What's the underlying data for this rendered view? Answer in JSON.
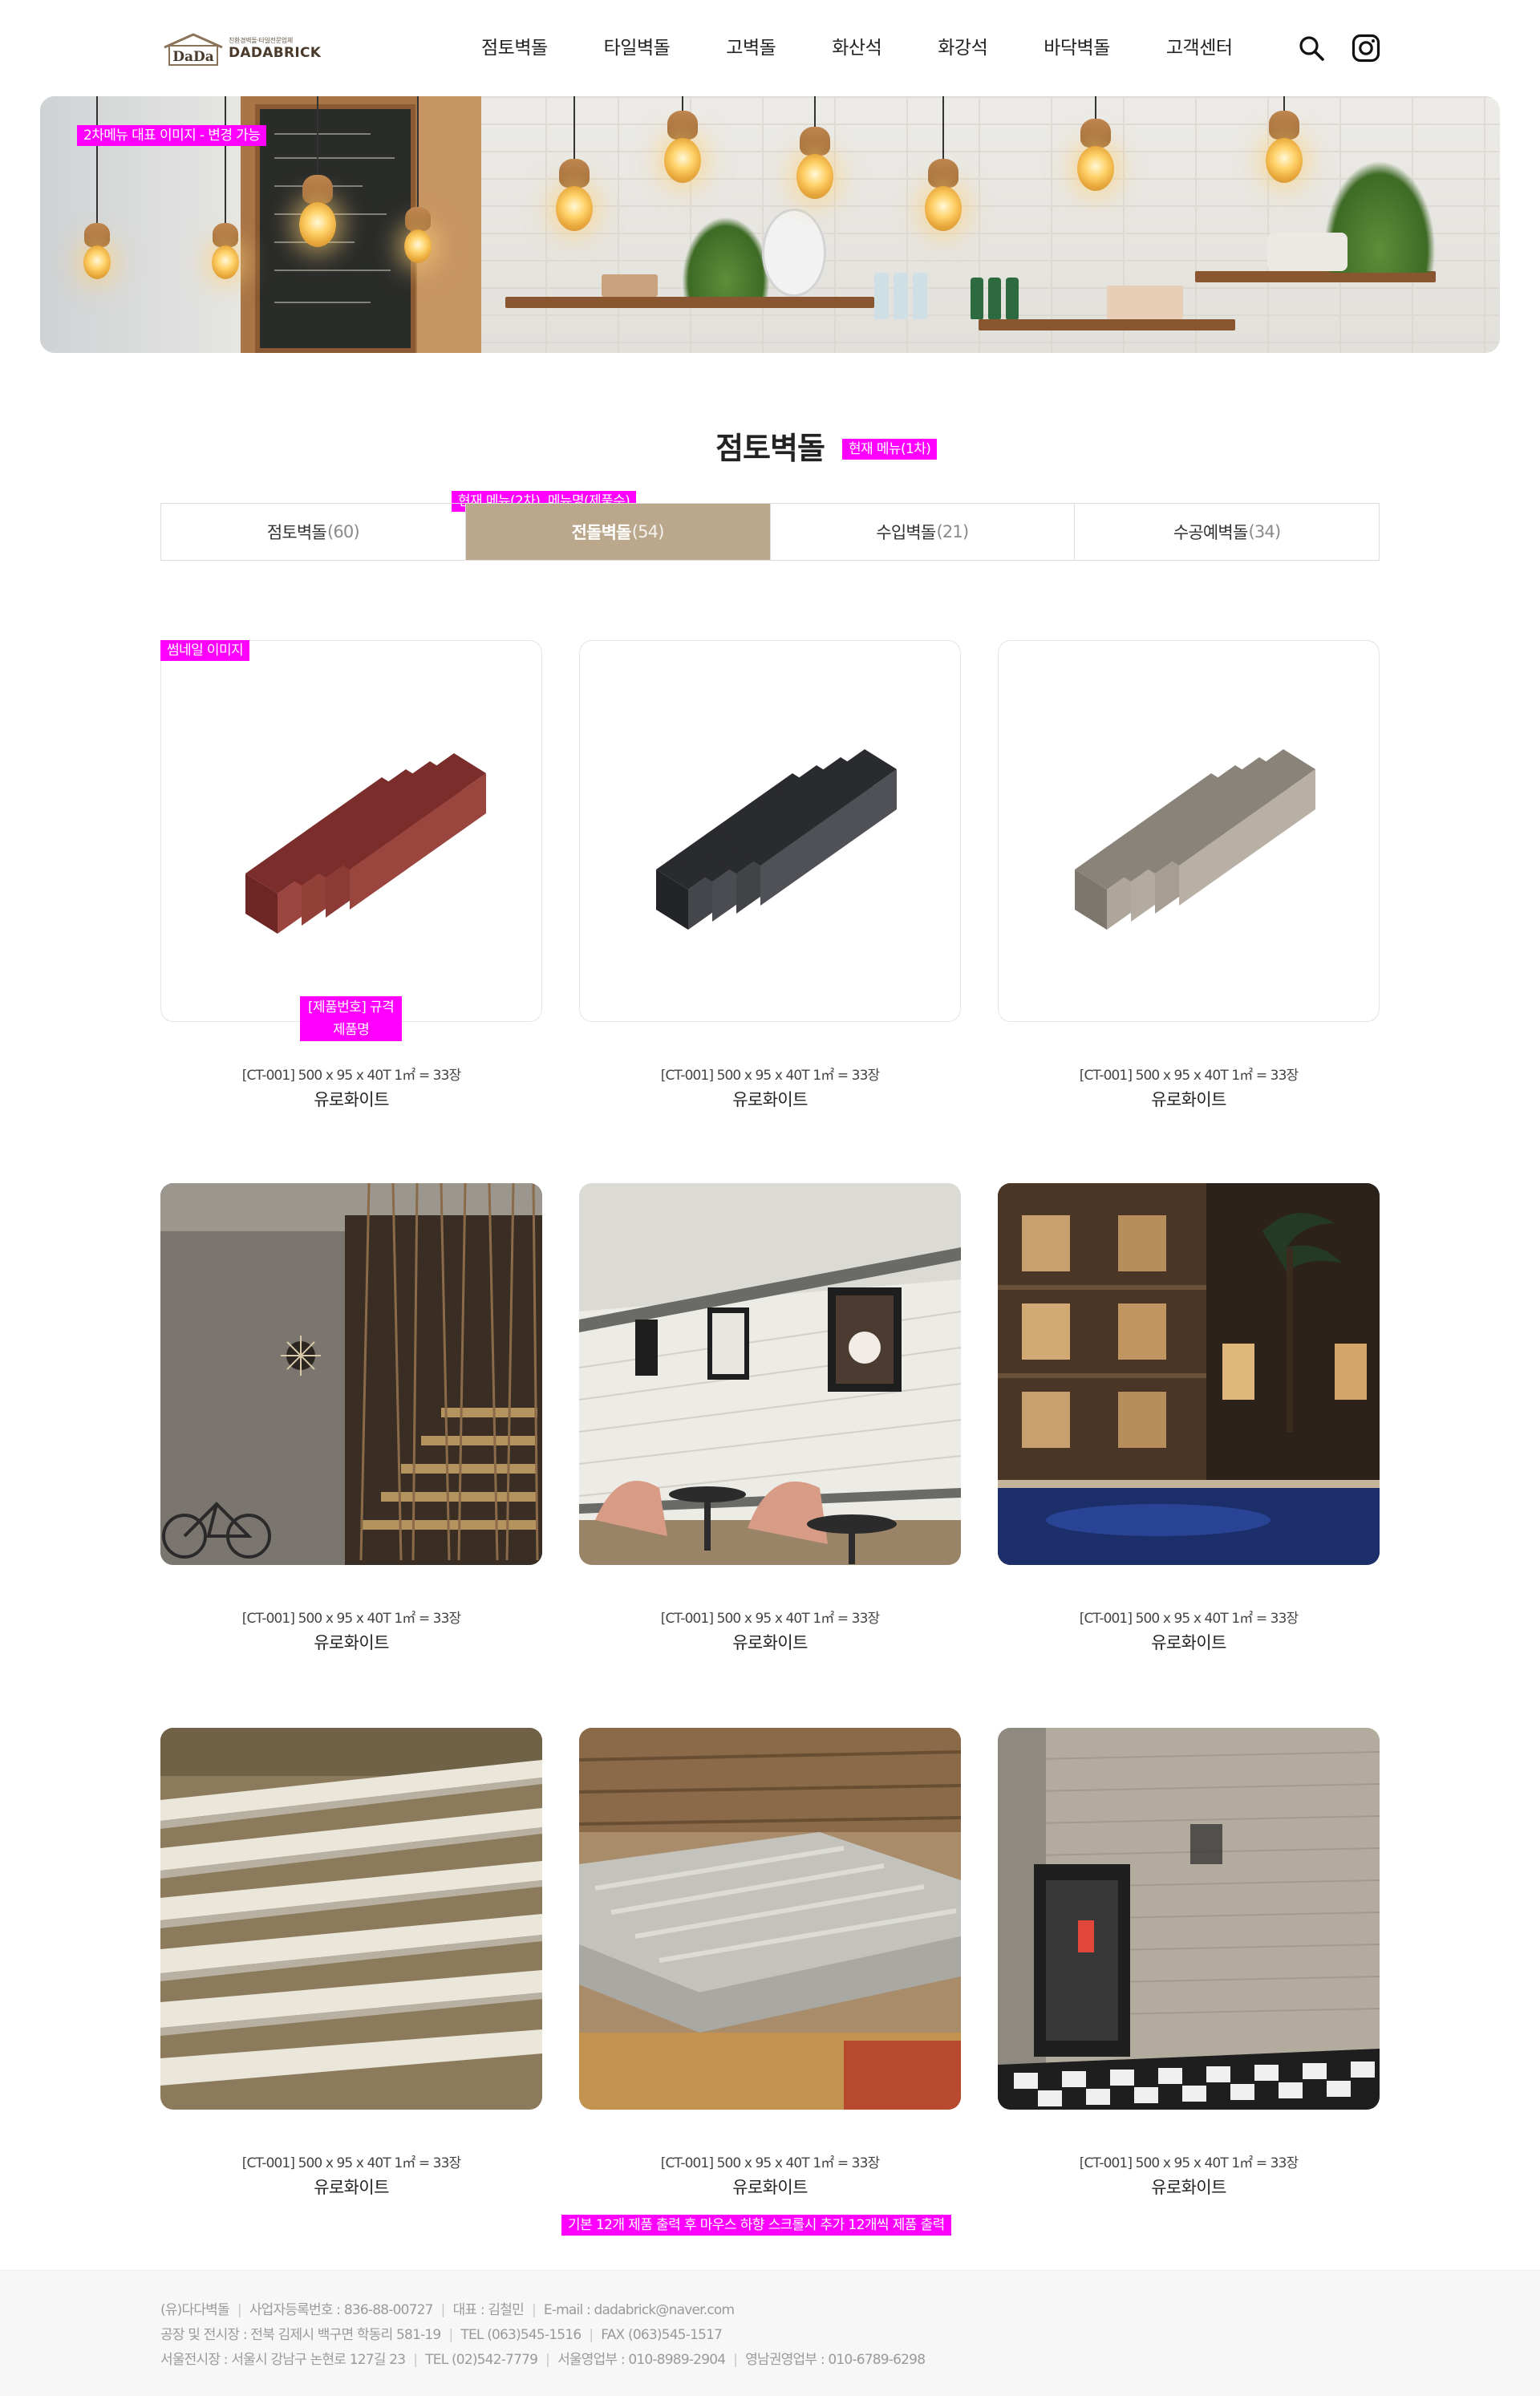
{
  "header": {
    "logo": {
      "brand": "DADABRICK",
      "tagline": "친환경벽돌·타일전문업체",
      "logo_letters": "DaDa"
    },
    "nav": [
      "점토벽돌",
      "타일벽돌",
      "고벽돌",
      "화산석",
      "화강석",
      "바닥벽돌",
      "고객센터"
    ],
    "icons": {
      "search": "search-icon",
      "instagram": "instagram-icon"
    }
  },
  "hero": {
    "annotation": "2차메뉴 대표 이미지 - 변경 가능"
  },
  "section": {
    "title": "점토벽돌",
    "annotation": "현재 메뉴(1차)"
  },
  "tabs": {
    "annotation": "현재 메뉴(2차), 메뉴명(제품수)",
    "items": [
      {
        "label": "점토벽돌",
        "count": "(60)",
        "active": false
      },
      {
        "label": "전돌벽돌",
        "count": "(54)",
        "active": true
      },
      {
        "label": "수입벽돌",
        "count": "(21)",
        "active": false
      },
      {
        "label": "수공예벽돌",
        "count": "(34)",
        "active": false
      }
    ]
  },
  "products": {
    "thumb_annotation": "썸네일 이미지",
    "info_annotation": "[제품번호] 규격\n제품명",
    "items": [
      {
        "spec": "[CT-001] 500 x 95 x 40T 1㎡ = 33장",
        "name": "유로화이트",
        "image": "red-brick-bundle"
      },
      {
        "spec": "[CT-001] 500 x 95 x 40T 1㎡ = 33장",
        "name": "유로화이트",
        "image": "black-brick-bundle"
      },
      {
        "spec": "[CT-001] 500 x 95 x 40T 1㎡ = 33장",
        "name": "유로화이트",
        "image": "gray-brick-bundle"
      },
      {
        "spec": "[CT-001] 500 x 95 x 40T 1㎡ = 33장",
        "name": "유로화이트",
        "image": "stair-wall-photo"
      },
      {
        "spec": "[CT-001] 500 x 95 x 40T 1㎡ = 33장",
        "name": "유로화이트",
        "image": "cafe-wall-photo"
      },
      {
        "spec": "[CT-001] 500 x 95 x 40T 1㎡ = 33장",
        "name": "유로화이트",
        "image": "pool-building-photo"
      },
      {
        "spec": "[CT-001] 500 x 95 x 40T 1㎡ = 33장",
        "name": "유로화이트",
        "image": "stacked-slats-photo"
      },
      {
        "spec": "[CT-001] 500 x 95 x 40T 1㎡ = 33장",
        "name": "유로화이트",
        "image": "warehouse-stacks-photo"
      },
      {
        "spec": "[CT-001] 500 x 95 x 40T 1㎡ = 33장",
        "name": "유로화이트",
        "image": "storefront-photo"
      }
    ],
    "load_more_annotation": "기본 12개 제품 출력 후 마우스 하향 스크롤시 추가 12개씩 제품 출력"
  },
  "footer": {
    "lines": [
      [
        "(유)다다벽돌",
        "사업자등록번호 : 836-88-00727",
        "대표 : 김철민",
        "E-mail : dadabrick@naver.com"
      ],
      [
        "공장 및 전시장 : 전북 김제시 백구면 학동리 581-19",
        "TEL (063)545-1516",
        "FAX (063)545-1517"
      ],
      [
        "서울전시장 : 서울시 강남구 논현로 127길 23",
        "TEL (02)542-7779",
        "서울영업부 : 010-8989-2904",
        "영남권영업부 : 010-6789-6298"
      ]
    ]
  },
  "colors": {
    "active_tab": "#bba88c",
    "annotation": "#ff00ff",
    "brick_red": "#8e3a36",
    "brick_black": "#3a3b3e",
    "brick_gray": "#a39c92"
  }
}
